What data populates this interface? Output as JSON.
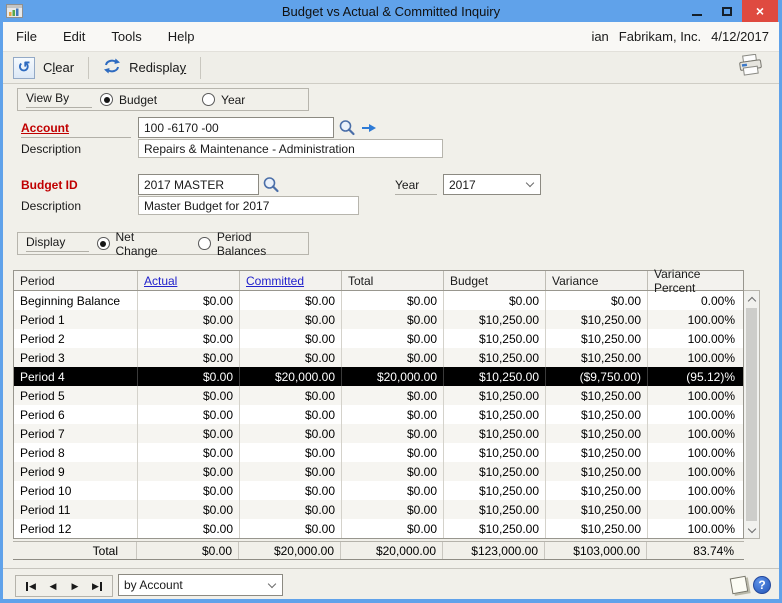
{
  "window": {
    "title": "Budget vs Actual & Committed Inquiry",
    "user": "ian",
    "company": "Fabrikam, Inc.",
    "date": "4/12/2017",
    "titlebar_color": "#60A2EA",
    "close_color": "#DF4A40"
  },
  "menu": {
    "items": [
      "File",
      "Edit",
      "Tools",
      "Help"
    ]
  },
  "toolbar": {
    "clear": {
      "pre": "C",
      "key": "l",
      "post": "ear"
    },
    "redisplay": {
      "pre": "Redispla",
      "key": "y",
      "post": ""
    }
  },
  "view_by": {
    "label": "View By",
    "budget": "Budget",
    "year": "Year",
    "selected": "Budget"
  },
  "account": {
    "label": "Account",
    "value": "100 -6170 -00",
    "desc_label": "Description",
    "description": "Repairs & Maintenance - Administration",
    "label_color": "#C00000"
  },
  "budget": {
    "label": "Budget ID",
    "value": "2017 MASTER",
    "desc_label": "Description",
    "description": "Master Budget for 2017",
    "year_label": "Year",
    "year_value": "2017"
  },
  "display": {
    "label": "Display",
    "net_change": "Net Change",
    "period_balances": "Period Balances",
    "selected": "Net Change"
  },
  "grid": {
    "columns": [
      "Period",
      "Actual",
      "Committed",
      "Total",
      "Budget",
      "Variance",
      "Variance Percent"
    ],
    "link_columns": [
      "Actual",
      "Committed"
    ],
    "link_color": "#2222CC",
    "selected_row_bg": "#000000",
    "rows": [
      {
        "period": "Beginning Balance",
        "actual": "$0.00",
        "committed": "$0.00",
        "total": "$0.00",
        "budget": "$0.00",
        "variance": "$0.00",
        "variance_pct": "0.00%",
        "selected": false
      },
      {
        "period": "Period 1",
        "actual": "$0.00",
        "committed": "$0.00",
        "total": "$0.00",
        "budget": "$10,250.00",
        "variance": "$10,250.00",
        "variance_pct": "100.00%",
        "selected": false
      },
      {
        "period": "Period 2",
        "actual": "$0.00",
        "committed": "$0.00",
        "total": "$0.00",
        "budget": "$10,250.00",
        "variance": "$10,250.00",
        "variance_pct": "100.00%",
        "selected": false
      },
      {
        "period": "Period 3",
        "actual": "$0.00",
        "committed": "$0.00",
        "total": "$0.00",
        "budget": "$10,250.00",
        "variance": "$10,250.00",
        "variance_pct": "100.00%",
        "selected": false
      },
      {
        "period": "Period 4",
        "actual": "$0.00",
        "committed": "$20,000.00",
        "total": "$20,000.00",
        "budget": "$10,250.00",
        "variance": "($9,750.00)",
        "variance_pct": "(95.12)%",
        "selected": true
      },
      {
        "period": "Period 5",
        "actual": "$0.00",
        "committed": "$0.00",
        "total": "$0.00",
        "budget": "$10,250.00",
        "variance": "$10,250.00",
        "variance_pct": "100.00%",
        "selected": false
      },
      {
        "period": "Period 6",
        "actual": "$0.00",
        "committed": "$0.00",
        "total": "$0.00",
        "budget": "$10,250.00",
        "variance": "$10,250.00",
        "variance_pct": "100.00%",
        "selected": false
      },
      {
        "period": "Period 7",
        "actual": "$0.00",
        "committed": "$0.00",
        "total": "$0.00",
        "budget": "$10,250.00",
        "variance": "$10,250.00",
        "variance_pct": "100.00%",
        "selected": false
      },
      {
        "period": "Period 8",
        "actual": "$0.00",
        "committed": "$0.00",
        "total": "$0.00",
        "budget": "$10,250.00",
        "variance": "$10,250.00",
        "variance_pct": "100.00%",
        "selected": false
      },
      {
        "period": "Period 9",
        "actual": "$0.00",
        "committed": "$0.00",
        "total": "$0.00",
        "budget": "$10,250.00",
        "variance": "$10,250.00",
        "variance_pct": "100.00%",
        "selected": false
      },
      {
        "period": "Period 10",
        "actual": "$0.00",
        "committed": "$0.00",
        "total": "$0.00",
        "budget": "$10,250.00",
        "variance": "$10,250.00",
        "variance_pct": "100.00%",
        "selected": false
      },
      {
        "period": "Period 11",
        "actual": "$0.00",
        "committed": "$0.00",
        "total": "$0.00",
        "budget": "$10,250.00",
        "variance": "$10,250.00",
        "variance_pct": "100.00%",
        "selected": false
      },
      {
        "period": "Period 12",
        "actual": "$0.00",
        "committed": "$0.00",
        "total": "$0.00",
        "budget": "$10,250.00",
        "variance": "$10,250.00",
        "variance_pct": "100.00%",
        "selected": false
      }
    ],
    "total": {
      "label": "Total",
      "actual": "$0.00",
      "committed": "$20,000.00",
      "total": "$20,000.00",
      "budget": "$123,000.00",
      "variance": "$103,000.00",
      "variance_pct": "83.74%"
    }
  },
  "footer": {
    "combo_value": "by Account"
  }
}
